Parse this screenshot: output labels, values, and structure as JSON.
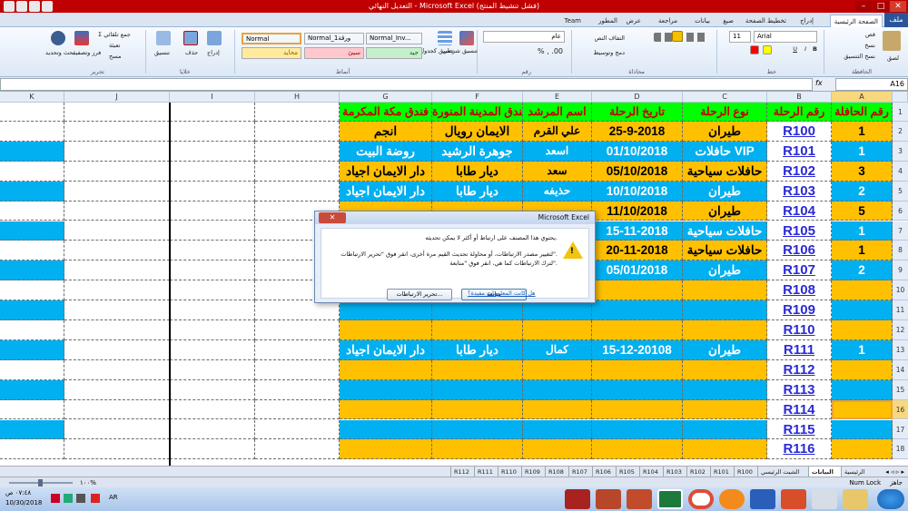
{
  "window": {
    "title": "التعديل النهائي - Microsoft Excel (فشل تنشيط المنتج)",
    "minimize": "–",
    "maximize": "□",
    "close": "✕"
  },
  "ribbon_tabs": [
    {
      "label": "ملف",
      "active": false
    },
    {
      "label": "الصفحة الرئيسية",
      "active": true
    },
    {
      "label": "إدراج",
      "active": false
    },
    {
      "label": "تخطيط الصفحة",
      "active": false
    },
    {
      "label": "صيغ",
      "active": false
    },
    {
      "label": "بيانات",
      "active": false
    },
    {
      "label": "مراجعة",
      "active": false
    },
    {
      "label": "عرض",
      "active": false
    },
    {
      "label": "المطور",
      "active": false
    },
    {
      "label": "Team",
      "active": false
    }
  ],
  "ribbon": {
    "clipboard": {
      "group": "الحافظة",
      "paste": "لصق",
      "cut": "قص",
      "copy": "نسخ",
      "format_painter": "نسخ التنسيق"
    },
    "font": {
      "group": "خط",
      "name": "Arial",
      "size": "11"
    },
    "alignment": {
      "group": "محاذاة",
      "wrap": "التفاف النص",
      "merge": "دمج وتوسيط"
    },
    "number": {
      "group": "رقم",
      "format": "عام"
    },
    "styles": {
      "group": "أنماط",
      "conditional": "تنسيق شرطي",
      "as_table": "تنسيق كجدول",
      "boxes": [
        {
          "label": "Normal",
          "bg": "#ffffff"
        },
        {
          "label": "Normal_ورقة1",
          "bg": "#ffffff"
        },
        {
          "label": "Normal_Inv...",
          "bg": "#ffffff"
        },
        {
          "label": "محايد",
          "bg": "#ffeb9c"
        },
        {
          "label": "سيئ",
          "bg": "#ffc7ce"
        },
        {
          "label": "جيد",
          "bg": "#c6efce"
        }
      ]
    },
    "cells": {
      "group": "خلايا",
      "insert": "إدراج",
      "delete": "حذف",
      "format": "تنسيق"
    },
    "editing": {
      "group": "تحرير",
      "autosum": "جمع تلقائي",
      "fill": "تعبئة",
      "clear": "مسح",
      "sort": "فرز وتصفية",
      "find": "بحث وتحديد"
    }
  },
  "formula_bar": {
    "name_box": "A16",
    "fx": "fx",
    "formula": ""
  },
  "columns": [
    "K",
    "J",
    "I",
    "H",
    "G",
    "F",
    "E",
    "D",
    "C",
    "B",
    "A"
  ],
  "header_row": {
    "A": "رقم الحافلة",
    "B": "رقم الرحلة",
    "C": "نوع الرحلة",
    "D": "تاريخ الرحلة",
    "E": "اسم المرشد",
    "F": "فندق المدينة المنورة",
    "G": "فندق مكة المكرمة"
  },
  "rows": [
    {
      "n": "2",
      "A": "1",
      "B": "R100",
      "C": "طيران",
      "D": "25-9-2018",
      "E": "علي القرم",
      "F": "الايمان رويال",
      "G": "انجم"
    },
    {
      "n": "3",
      "A": "1",
      "B": "R101",
      "C": "حافلات VIP",
      "D": "01/10/2018",
      "E": "اسعد",
      "F": "جوهرة الرشيد",
      "G": "روضة البيت"
    },
    {
      "n": "4",
      "A": "3",
      "B": "R102",
      "C": "حافلات سياحية",
      "D": "05/10/2018",
      "E": "سعد",
      "F": "ديار طابا",
      "G": "دار الايمان اجياد"
    },
    {
      "n": "5",
      "A": "2",
      "B": "R103",
      "C": "طيران",
      "D": "10/10/2018",
      "E": "حذيفه",
      "F": "ديار طابا",
      "G": "دار الايمان اجياد"
    },
    {
      "n": "6",
      "A": "5",
      "B": "R104",
      "C": "طيران",
      "D": "11/10/2018",
      "E": "",
      "F": "",
      "G": ""
    },
    {
      "n": "7",
      "A": "1",
      "B": "R105",
      "C": "حافلات سياحية",
      "D": "15-11-2018",
      "E": "",
      "F": "",
      "G": ""
    },
    {
      "n": "8",
      "A": "1",
      "B": "R106",
      "C": "حافلات سياحية",
      "D": "20-11-2018",
      "E": "",
      "F": "",
      "G": ""
    },
    {
      "n": "9",
      "A": "2",
      "B": "R107",
      "C": "طيران",
      "D": "05/01/2018",
      "E": "",
      "F": "",
      "G": ""
    },
    {
      "n": "10",
      "A": "",
      "B": "R108",
      "C": "",
      "D": "",
      "E": "",
      "F": "",
      "G": ""
    },
    {
      "n": "11",
      "A": "",
      "B": "R109",
      "C": "",
      "D": "",
      "E": "",
      "F": "",
      "G": ""
    },
    {
      "n": "12",
      "A": "",
      "B": "R110",
      "C": "",
      "D": "",
      "E": "",
      "F": "",
      "G": ""
    },
    {
      "n": "13",
      "A": "1",
      "B": "R111",
      "C": "طيران",
      "D": "15-12-20108",
      "E": "كمال",
      "F": "ديار طابا",
      "G": "دار الايمان اجياد"
    },
    {
      "n": "14",
      "A": "",
      "B": "R112",
      "C": "",
      "D": "",
      "E": "",
      "F": "",
      "G": ""
    },
    {
      "n": "15",
      "A": "",
      "B": "R113",
      "C": "",
      "D": "",
      "E": "",
      "F": "",
      "G": ""
    },
    {
      "n": "16",
      "A": "",
      "B": "R114",
      "C": "",
      "D": "",
      "E": "",
      "F": "",
      "G": ""
    },
    {
      "n": "17",
      "A": "",
      "B": "R115",
      "C": "",
      "D": "",
      "E": "",
      "F": "",
      "G": ""
    },
    {
      "n": "18",
      "A": "",
      "B": "R116",
      "C": "",
      "D": "",
      "E": "",
      "F": "",
      "G": ""
    }
  ],
  "header_row_number": "1",
  "colors": {
    "green": "#00ff00",
    "orange": "#ffc000",
    "blue": "#00b0f0",
    "link": "#2a2ad6"
  },
  "dialog": {
    "title": "Microsoft Excel",
    "line1": "يحتوي هذا المصنف على ارتباط أو أكثر لا يمكن تحديثه.",
    "line2": "لتغيير مصدر الارتباطات، أو محاولة تحديث القيم مرة أخرى، انقر فوق \"تحرير الارتباطات\".",
    "line3": "لترك الارتباطات كما هي، انقر فوق \"متابعة\".",
    "continue": "متابعة",
    "edit_links": "تحرير الارتباطات...",
    "help_link": "هل كانت المعلومات مفيدة؟",
    "warning_icon": "warning-icon"
  },
  "sheet_tabs": [
    "الرئيسية",
    "البيانات",
    "الشيت الرئيسي",
    "R100",
    "R101",
    "R102",
    "R103",
    "R104",
    "R105",
    "R106",
    "R107",
    "R108",
    "R109",
    "R110",
    "R111",
    "R112"
  ],
  "active_sheet": "البيانات",
  "status": {
    "ready": "جاهز",
    "num_lock": "Num Lock",
    "zoom": "١٠٠%"
  },
  "taskbar": {
    "lang": "AR",
    "time": "٠٧:٤٨ ص",
    "date": "10/30/2018"
  }
}
